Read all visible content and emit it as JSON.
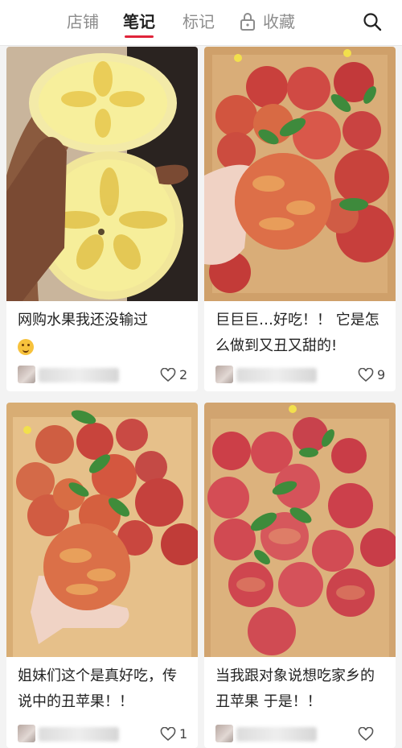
{
  "tabs": [
    {
      "label": "店铺"
    },
    {
      "label": "笔记"
    },
    {
      "label": "标记"
    },
    {
      "label": "收藏"
    }
  ],
  "notes": [
    {
      "title": "网购水果我还没输过",
      "likes": "2"
    },
    {
      "title": "巨巨巨…好吃！！ 它是怎么做到又丑又甜的!",
      "likes": "9"
    },
    {
      "title": "姐妹们这个是真好吃，传说中的丑苹果！！",
      "likes": "1"
    },
    {
      "title": "当我跟对象说想吃家乡的丑苹果 于是！！",
      "likes": ""
    }
  ],
  "colors": {
    "accent": "#e0243a",
    "active_tab": "#222222",
    "inactive_tab": "#8c8c8c"
  },
  "icons": [
    "lock-icon",
    "search-icon",
    "heart-icon",
    "smiley-emoji"
  ]
}
